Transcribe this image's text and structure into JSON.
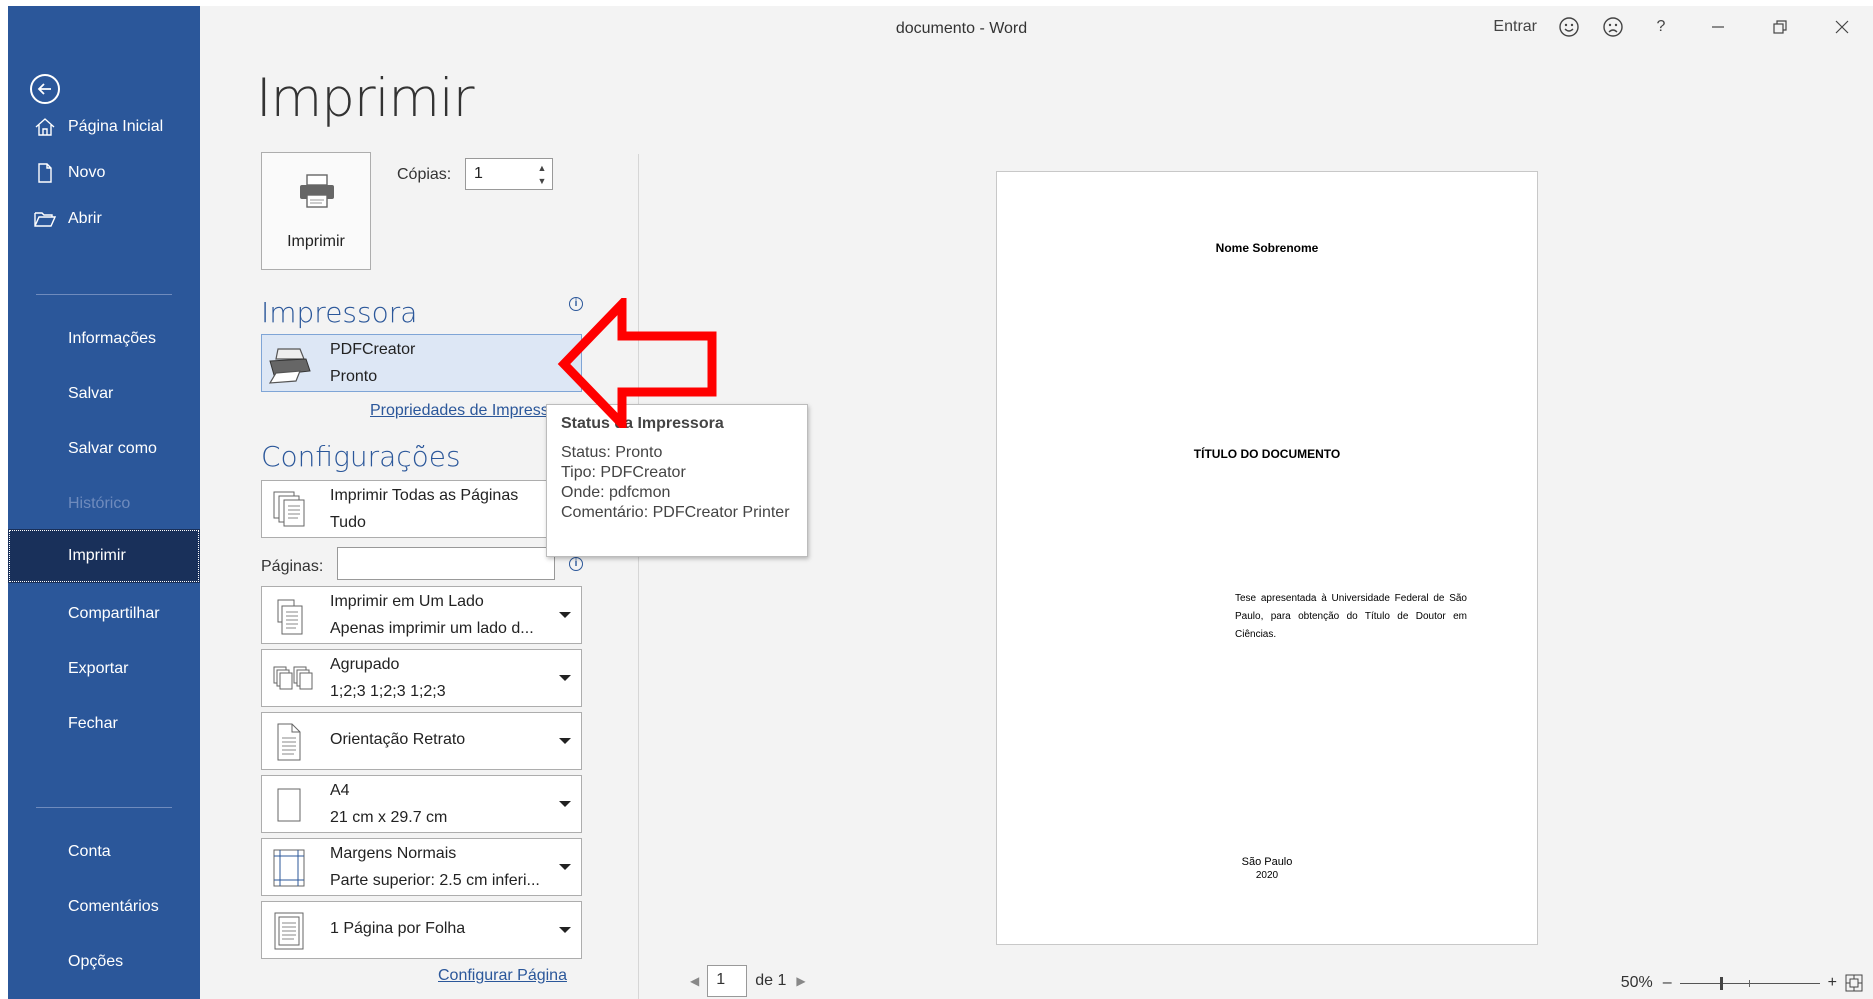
{
  "window": {
    "title": "documento  -  Word",
    "signin": "Entrar",
    "help": "?"
  },
  "sidebar": {
    "items": [
      {
        "label": "Página Inicial"
      },
      {
        "label": "Novo"
      },
      {
        "label": "Abrir"
      },
      {
        "label": "Informações"
      },
      {
        "label": "Salvar"
      },
      {
        "label": "Salvar como"
      },
      {
        "label": "Histórico"
      },
      {
        "label": "Imprimir"
      },
      {
        "label": "Compartilhar"
      },
      {
        "label": "Exportar"
      },
      {
        "label": "Fechar"
      },
      {
        "label": "Conta"
      },
      {
        "label": "Comentários"
      },
      {
        "label": "Opções"
      }
    ]
  },
  "main": {
    "title": "Imprimir",
    "print_button": "Imprimir",
    "copies_label": "Cópias:",
    "copies_value": "1"
  },
  "printer": {
    "heading": "Impressora",
    "name": "PDFCreator",
    "status": "Pronto",
    "properties_link": "Propriedades de Impressora"
  },
  "tooltip": {
    "title": "Status da Impressora",
    "status": "Status: Pronto",
    "type": "Tipo: PDFCreator",
    "where": "Onde: pdfcmon",
    "comment": "Comentário: PDFCreator Printer"
  },
  "settings": {
    "heading": "Configurações",
    "pages_label": "Páginas:",
    "pages_value": "",
    "options": [
      {
        "line1": "Imprimir Todas as Páginas",
        "line2": "Tudo"
      },
      {
        "line1": "Imprimir em Um Lado",
        "line2": "Apenas imprimir um lado d..."
      },
      {
        "line1": "Agrupado",
        "line2": "1;2;3    1;2;3    1;2;3"
      },
      {
        "line1": "Orientação Retrato",
        "line2": ""
      },
      {
        "line1": "A4",
        "line2": "21 cm x 29.7 cm"
      },
      {
        "line1": "Margens Normais",
        "line2": "Parte superior: 2.5 cm inferi..."
      },
      {
        "line1": "1 Página por Folha",
        "line2": ""
      }
    ],
    "page_setup_link": "Configurar Página"
  },
  "preview": {
    "author": "Nome Sobrenome",
    "doc_title": "TÍTULO DO DOCUMENTO",
    "thesis_text": "Tese apresentada à Universidade Federal de São Paulo, para obtenção do Título de Doutor em Ciências.",
    "city": "São Paulo",
    "year": "2020"
  },
  "navigation": {
    "current_page": "1",
    "of_label": "de 1"
  },
  "zoom": {
    "level": "50%",
    "level_value": 50,
    "minus": "–",
    "plus": "+"
  },
  "colors": {
    "accent": "#2b579a",
    "sidebar_active": "#19305a",
    "annotation_arrow": "#ff0000"
  },
  "icons": [
    "back-arrow-icon",
    "home-icon",
    "new-document-icon",
    "open-folder-icon",
    "smiley-icon",
    "frown-icon",
    "minimize-icon",
    "restore-icon",
    "close-icon",
    "printer-icon",
    "info-icon",
    "pages-icon",
    "one-side-icon",
    "collated-icon",
    "portrait-icon",
    "paper-size-icon",
    "margins-icon",
    "pages-per-sheet-icon",
    "fit-page-icon"
  ]
}
